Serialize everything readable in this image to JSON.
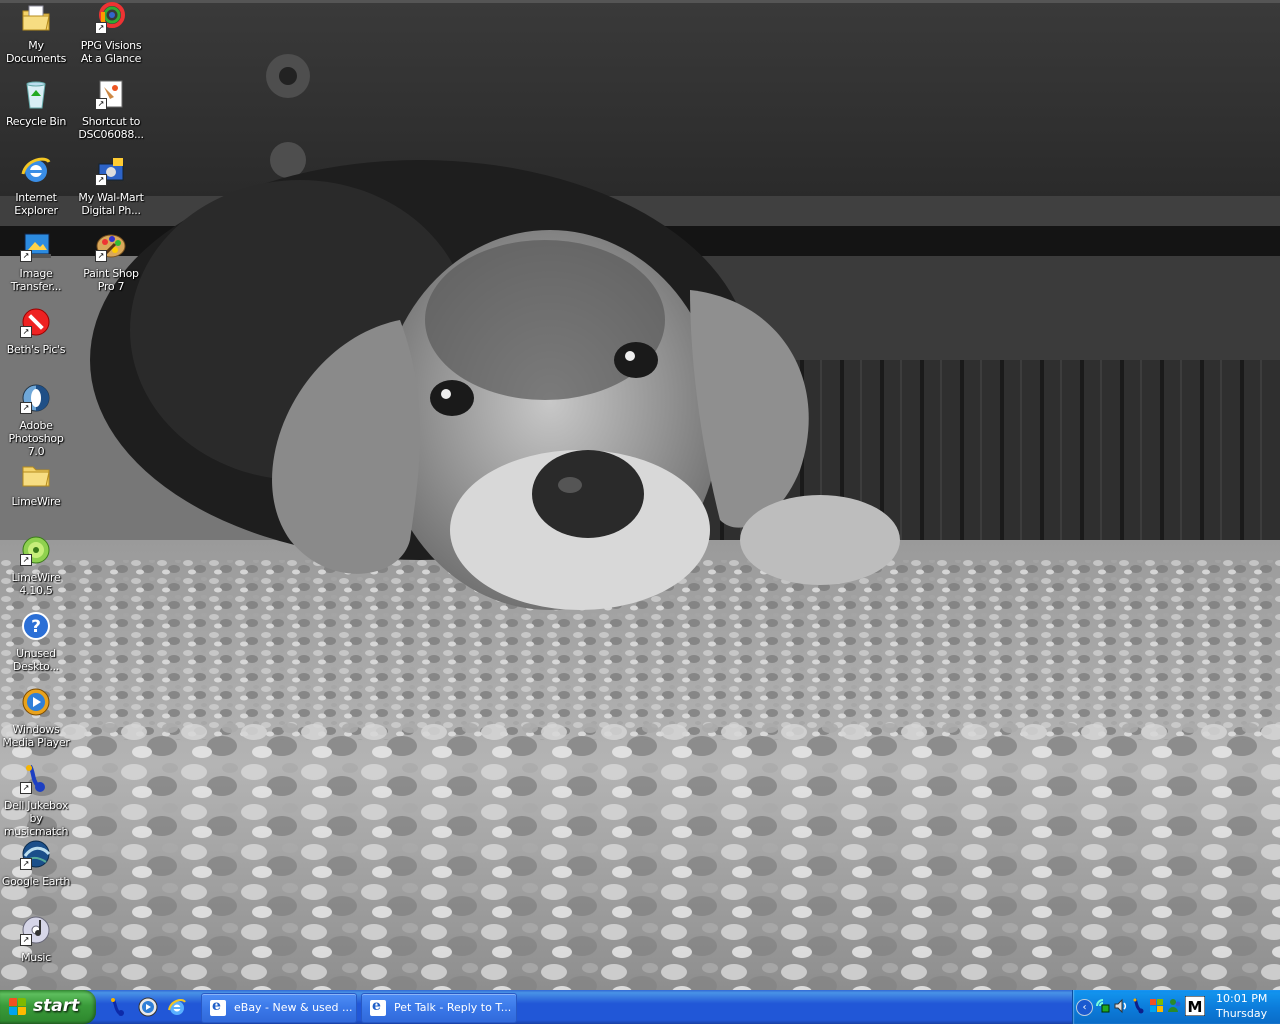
{
  "desktop": {
    "icons": [
      {
        "label": "My Documents",
        "icon": "folder-documents-icon"
      },
      {
        "label": "PPG Visions At a Glance",
        "icon": "ppg-shortcut-icon"
      },
      {
        "label": "Recycle Bin",
        "icon": "recycle-bin-icon"
      },
      {
        "label": "Shortcut to DSC06088...",
        "icon": "image-shortcut-icon"
      },
      {
        "label": "Internet Explorer",
        "icon": "internet-explorer-icon"
      },
      {
        "label": "My Wal-Mart Digital Ph...",
        "icon": "walmart-photo-icon"
      },
      {
        "label": "Image Transfer...",
        "icon": "image-transfer-icon"
      },
      {
        "label": "Paint Shop Pro 7",
        "icon": "paint-shop-pro-icon"
      },
      {
        "label": "Beth's Pic's",
        "icon": "no-entry-shortcut-icon"
      },
      {
        "label": "Adobe Photoshop 7.0",
        "icon": "photoshop-icon"
      },
      {
        "label": "LimeWire",
        "icon": "folder-icon"
      },
      {
        "label": "LimeWire 4.10.5",
        "icon": "limewire-icon"
      },
      {
        "label": "Unused Deskto...",
        "icon": "help-icon"
      },
      {
        "label": "Windows Media Player",
        "icon": "media-player-icon"
      },
      {
        "label": "Dell Jukebox by musicmatch",
        "icon": "jukebox-icon"
      },
      {
        "label": "Google Earth",
        "icon": "google-earth-icon"
      },
      {
        "label": "Music",
        "icon": "music-cd-icon"
      }
    ]
  },
  "taskbar": {
    "start_label": "start",
    "quick_launch": [
      "jukebox-icon",
      "media-player-icon",
      "internet-explorer-icon"
    ],
    "tasks": [
      {
        "label": "eBay - New & used ...",
        "icon": "internet-explorer-icon"
      },
      {
        "label": "Pet Talk - Reply to T...",
        "icon": "internet-explorer-icon"
      }
    ],
    "tray": {
      "icons": [
        "network-icon",
        "volume-icon",
        "jukebox-icon",
        "windows-flag-icon",
        "messenger-icon",
        "m-app-icon"
      ],
      "time": "10:01 PM",
      "day": "Thursday"
    }
  },
  "colors": {
    "taskbar_blue": "#2157d7",
    "start_green": "#3a9b3a",
    "tray_blue": "#0c7ddb"
  }
}
